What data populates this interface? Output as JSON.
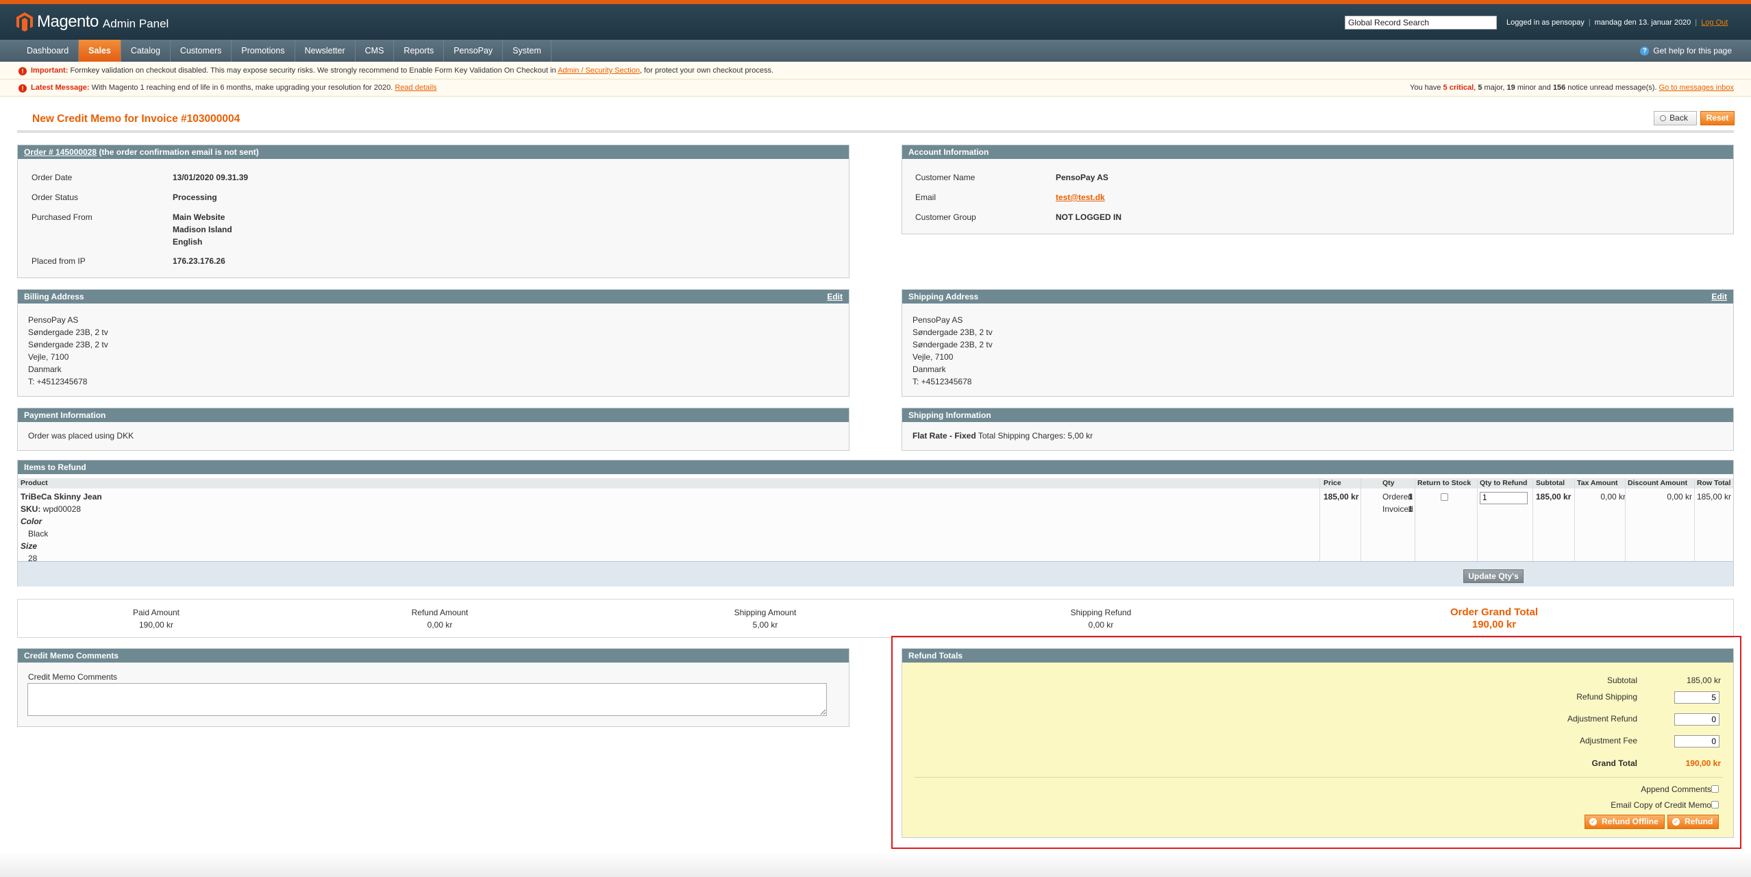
{
  "header": {
    "brand": "Magento",
    "subtitle": "Admin Panel",
    "search_value": "Global Record Search",
    "logged_in": "Logged in as pensopay",
    "date": "mandag den 13. januar 2020",
    "logout": "Log Out"
  },
  "nav": {
    "items": [
      "Dashboard",
      "Sales",
      "Catalog",
      "Customers",
      "Promotions",
      "Newsletter",
      "CMS",
      "Reports",
      "PensoPay",
      "System"
    ],
    "active": "Sales",
    "help": "Get help for this page"
  },
  "messages": {
    "important_label": "Important:",
    "important_text": "Formkey validation on checkout disabled. This may expose security risks. We strongly recommend to Enable Form Key Validation On Checkout in",
    "important_link": "Admin / Security Section",
    "important_tail": ", for protect your own checkout process.",
    "latest_label": "Latest Message:",
    "latest_text": "With Magento 1 reaching end of life in 6 months, make upgrading your resolution for 2020.",
    "latest_link": "Read details",
    "inbox_prefix": "You have",
    "inbox_critical": "5 critical",
    "inbox_major": "5",
    "inbox_major_label": "major,",
    "inbox_minor": "19",
    "inbox_minor_label": "minor and",
    "inbox_notice": "156",
    "inbox_notice_label": "notice unread message(s).",
    "inbox_link": "Go to messages inbox"
  },
  "page": {
    "title": "New Credit Memo for Invoice #103000004",
    "back": "Back",
    "reset": "Reset"
  },
  "order": {
    "link": "Order # 145000028",
    "note": "(the order confirmation email is not sent)",
    "date_label": "Order Date",
    "date": "13/01/2020 09.31.39",
    "status_label": "Order Status",
    "status": "Processing",
    "purchased_label": "Purchased From",
    "purchased_1": "Main Website",
    "purchased_2": "Madison Island",
    "purchased_3": "English",
    "ip_label": "Placed from IP",
    "ip": "176.23.176.26"
  },
  "account": {
    "title": "Account Information",
    "name_label": "Customer Name",
    "name": "PensoPay AS",
    "email_label": "Email",
    "email": "test@test.dk",
    "group_label": "Customer Group",
    "group": "NOT LOGGED IN"
  },
  "billing": {
    "title": "Billing Address",
    "edit": "Edit",
    "lines": [
      "PensoPay AS",
      "Søndergade 23B, 2 tv",
      "Søndergade 23B, 2 tv",
      "Vejle, 7100",
      "Danmark",
      "T: +4512345678"
    ]
  },
  "shipping": {
    "title": "Shipping Address",
    "edit": "Edit",
    "lines": [
      "PensoPay AS",
      "Søndergade 23B, 2 tv",
      "Søndergade 23B, 2 tv",
      "Vejle, 7100",
      "Danmark",
      "T: +4512345678"
    ]
  },
  "payment": {
    "title": "Payment Information",
    "text": "Order was placed using DKK"
  },
  "shipping_info": {
    "title": "Shipping Information",
    "method": "Flat Rate - Fixed",
    "charges": "Total Shipping Charges: 5,00 kr"
  },
  "items": {
    "title": "Items to Refund",
    "columns": [
      "Product",
      "Price",
      "Qty",
      "Return to Stock",
      "Qty to Refund",
      "Subtotal",
      "Tax Amount",
      "Discount Amount",
      "Row Total"
    ],
    "product_name": "TriBeCa Skinny Jean",
    "sku_label": "SKU:",
    "sku": "wpd00028",
    "opt1_label": "Color",
    "opt1_value": "Black",
    "opt2_label": "Size",
    "opt2_value": "28",
    "price": "185,00 kr",
    "ordered_label": "Ordered",
    "ordered": "1",
    "invoiced_label": "Invoiced",
    "invoiced": "1",
    "qty_to_refund": "1",
    "subtotal": "185,00 kr",
    "tax": "0,00 kr",
    "discount": "0,00 kr",
    "row_total": "185,00 kr",
    "update_button": "Update Qty's"
  },
  "summary": {
    "paid_label": "Paid Amount",
    "paid": "190,00 kr",
    "refund_label": "Refund Amount",
    "refund": "0,00 kr",
    "shipping_label": "Shipping Amount",
    "shipping": "5,00 kr",
    "shipping_refund_label": "Shipping Refund",
    "shipping_refund": "0,00 kr",
    "grand_label": "Order Grand Total",
    "grand": "190,00 kr"
  },
  "comments": {
    "title": "Credit Memo Comments",
    "label": "Credit Memo Comments"
  },
  "refund_totals": {
    "title": "Refund Totals",
    "subtotal_label": "Subtotal",
    "subtotal": "185,00 kr",
    "shipping_label": "Refund Shipping",
    "shipping": "5",
    "adj_refund_label": "Adjustment Refund",
    "adj_refund": "0",
    "adj_fee_label": "Adjustment Fee",
    "adj_fee": "0",
    "grand_label": "Grand Total",
    "grand": "190,00 kr",
    "append_label": "Append Comments",
    "email_label": "Email Copy of Credit Memo",
    "refund_offline": "Refund Offline",
    "refund": "Refund"
  }
}
